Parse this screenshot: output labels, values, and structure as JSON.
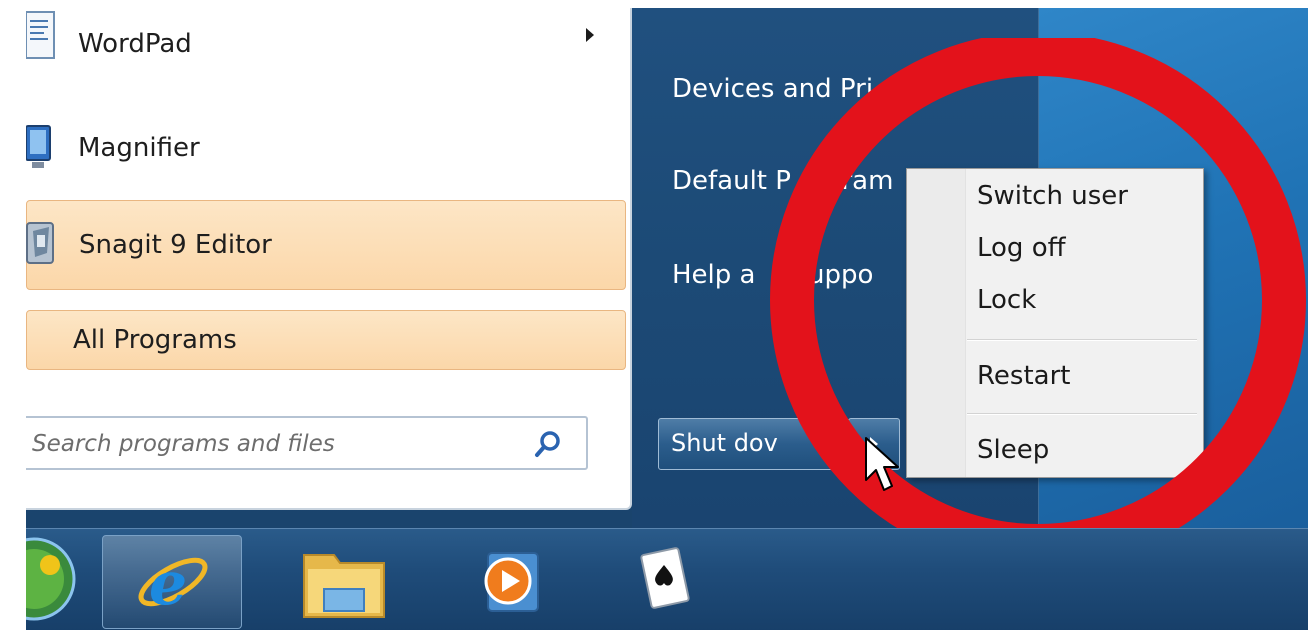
{
  "programs": [
    {
      "label": "WordPad",
      "icon": "wordpad-icon",
      "has_submenu": true
    },
    {
      "label": "Magnifier",
      "icon": "magnifier-icon",
      "has_submenu": false
    },
    {
      "label": "Snagit 9 Editor",
      "icon": "snagit-icon",
      "has_submenu": false
    }
  ],
  "all_programs": "All Programs",
  "search": {
    "placeholder": "Search programs and files",
    "icon": "search-icon"
  },
  "right_links": [
    "Devices and Pri",
    "Default P",
    "gram",
    "Help a",
    "Suppo"
  ],
  "shutdown": {
    "label": "Shut dov",
    "arrow_icon": "chevron-right-icon"
  },
  "power_menu": {
    "group1": [
      "Switch user",
      "Log off",
      "Lock"
    ],
    "group2": [
      "Restart"
    ],
    "group3": [
      "Sleep"
    ]
  },
  "taskbar": [
    "start-orb-icon",
    "internet-explorer-icon",
    "file-explorer-icon",
    "media-player-icon",
    "solitaire-icon"
  ],
  "colors": {
    "highlight": "#fbd7a9",
    "annotation_ring": "#e3121b",
    "menu_blue": "#1c4a76"
  }
}
